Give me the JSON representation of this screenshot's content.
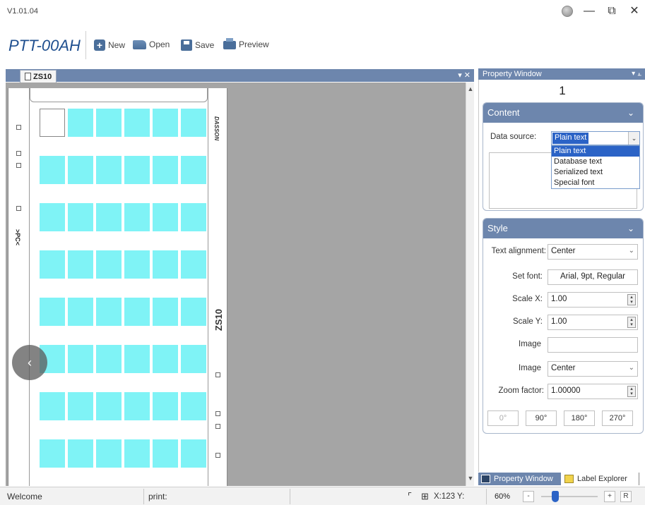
{
  "app": {
    "version": "V1.01.04",
    "model": "PTT-00AH"
  },
  "window_controls": {
    "globe_icon": "globe-icon",
    "minimize": "—",
    "restore": "⧉",
    "close": "✕"
  },
  "toolbar": {
    "new_label": "New",
    "open_label": "Open",
    "save_label": "Save",
    "preview_label": "Preview"
  },
  "document": {
    "tab_label": "ZS10",
    "tab_controls": "▾ ✕",
    "left_marker": ">PC<",
    "brand_text": "DASSON",
    "vertical_label": "ZS10",
    "nav_arrow": "‹"
  },
  "property_window": {
    "title": "Property Window",
    "pin": "▾ ⫠",
    "selected_number": "1",
    "content": {
      "header": "Content",
      "data_source_label": "Data source:",
      "data_source_value": "Plain text",
      "options": [
        "Plain text",
        "Database text",
        "Serialized text",
        "Special font"
      ]
    },
    "style": {
      "header": "Style",
      "text_alignment_label": "Text alignment:",
      "text_alignment_value": "Center",
      "set_font_label": "Set font:",
      "set_font_value": "Arial, 9pt, Regular",
      "scale_x_label": "Scale X:",
      "scale_x_value": "1.00",
      "scale_y_label": "Scale Y:",
      "scale_y_value": "1.00",
      "image_label": "Image",
      "image_value": "",
      "image_align_label": "Image",
      "image_align_value": "Center",
      "zoom_factor_label": "Zoom factor:",
      "zoom_factor_value": "1.00000",
      "rotations": [
        "0°",
        "90°",
        "180°",
        "270°"
      ]
    },
    "tabs": {
      "property_tab": "Property Window",
      "explorer_tab": "Label Explorer"
    }
  },
  "status_bar": {
    "welcome": "Welcome",
    "print": "print:",
    "coords": "X:123  Y:",
    "zoom_percent": "60%",
    "zoom_minus": "-",
    "zoom_plus": "+",
    "zoom_reset": "R",
    "zoom_level_fraction": 0.25
  },
  "colors": {
    "accent": "#6d86ad",
    "label_cell": "#7ff3f6",
    "selection": "#2b63c6",
    "canvas_bg": "#a5a5a5"
  }
}
